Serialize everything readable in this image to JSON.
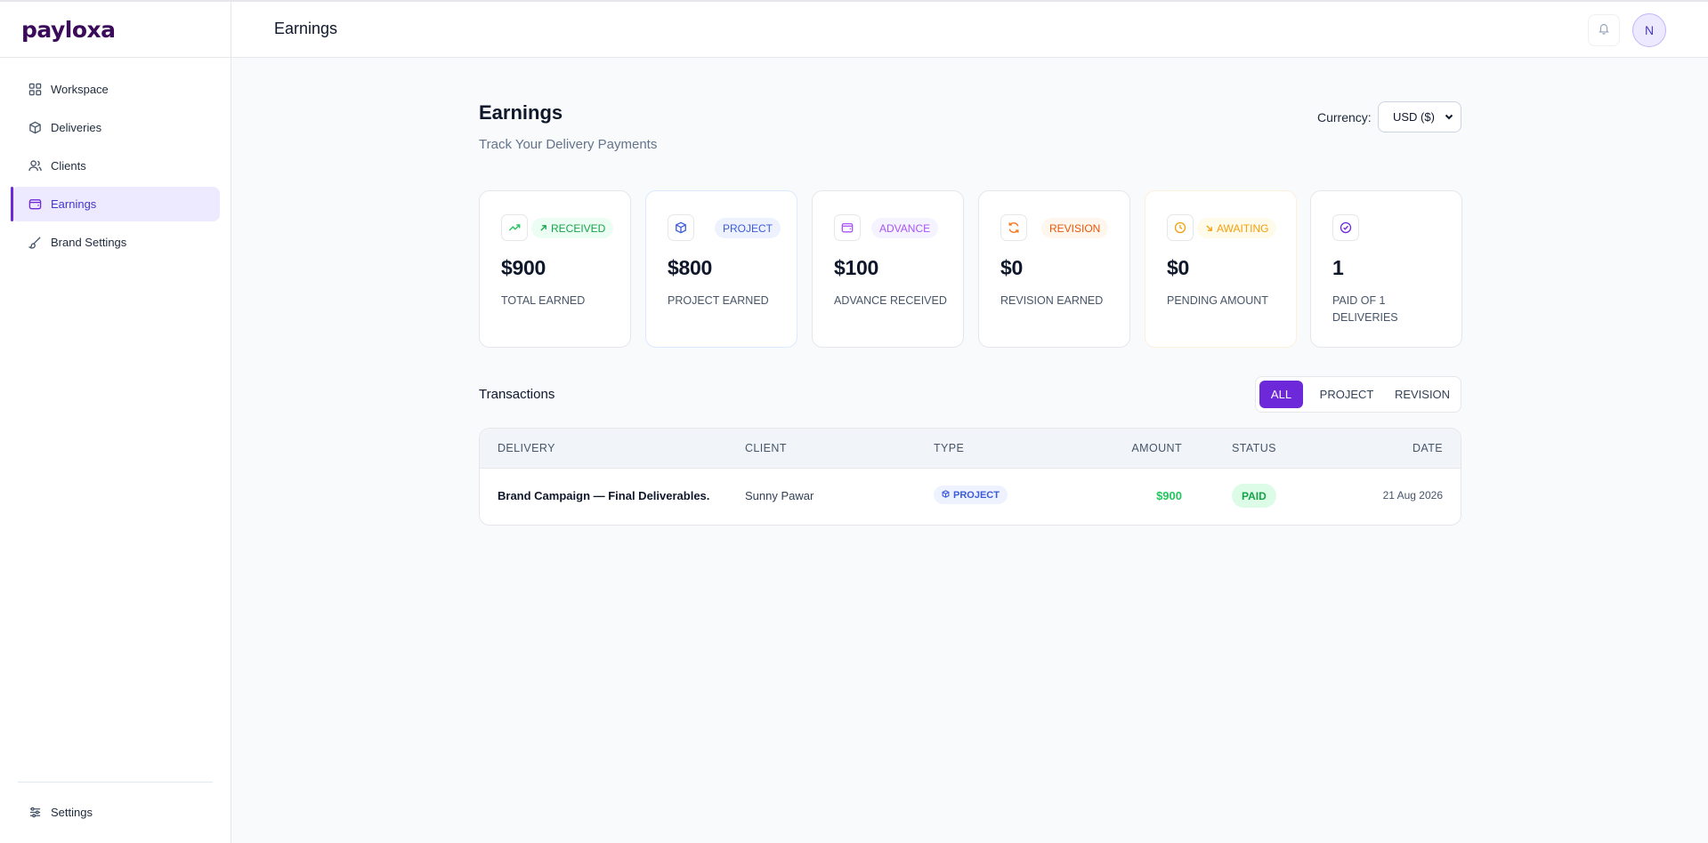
{
  "app": {
    "brand_name": "payloxa"
  },
  "header": {
    "title": "Earnings",
    "avatar_initial": "N"
  },
  "sidebar": {
    "items": [
      {
        "label": "Workspace",
        "icon": "grid-icon"
      },
      {
        "label": "Deliveries",
        "icon": "box-icon"
      },
      {
        "label": "Clients",
        "icon": "users-icon"
      },
      {
        "label": "Earnings",
        "icon": "wallet-icon",
        "active": true
      },
      {
        "label": "Brand Settings",
        "icon": "brush-icon"
      }
    ],
    "settings_label": "Settings"
  },
  "main": {
    "title": "Earnings",
    "subtitle": "Track Your Delivery Payments",
    "currency_label": "Currency:",
    "currency_value": "USD ($)"
  },
  "cards": [
    {
      "badge": "RECEIVED",
      "amount": "$900",
      "label": "TOTAL EARNED",
      "color": "#22c55e"
    },
    {
      "badge": "PROJECT",
      "amount": "$800",
      "label": "PROJECT EARNED",
      "color": "#3b5bdb"
    },
    {
      "badge": "ADVANCE",
      "amount": "$100",
      "label": "ADVANCE RECEIVED",
      "color": "#a855f7"
    },
    {
      "badge": "REVISION",
      "amount": "$0",
      "label": "REVISION EARNED",
      "color": "#f97316"
    },
    {
      "badge": "AWAITING",
      "amount": "$0",
      "label": "PENDING AMOUNT",
      "color": "#f59e0b"
    },
    {
      "badge": "",
      "amount": "1",
      "label": "PAID OF 1 DELIVERIES",
      "color": "#6d28d9"
    }
  ],
  "transactions": {
    "title": "Transactions",
    "tabs": [
      "ALL",
      "PROJECT",
      "REVISION"
    ],
    "active_tab": "ALL",
    "columns": [
      "DELIVERY",
      "CLIENT",
      "TYPE",
      "AMOUNT",
      "STATUS",
      "DATE"
    ],
    "rows": [
      {
        "delivery": "Brand Campaign — Final Deliverables.",
        "client": "Sunny Pawar",
        "type": "PROJECT",
        "amount": "$900",
        "status": "PAID",
        "date": "21 Aug 2026"
      }
    ]
  }
}
